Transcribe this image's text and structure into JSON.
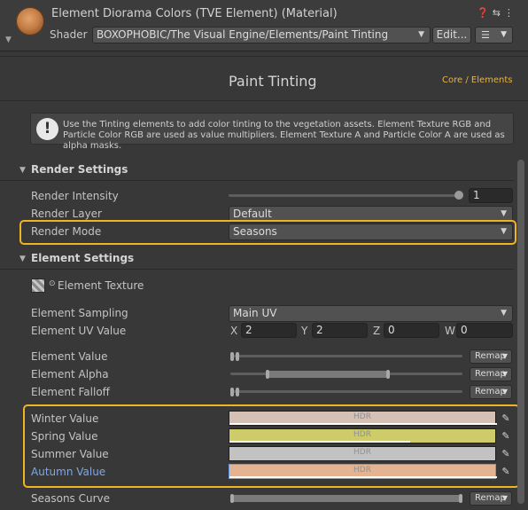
{
  "header": {
    "material_title": "Element Diorama Colors (TVE Element) (Material)",
    "shader_label": "Shader",
    "shader_value": "BOXOPHOBIC/The Visual Engine/Elements/Paint Tinting",
    "edit_label": "Edit...",
    "icons": [
      "help-icon",
      "settings-sliders-icon",
      "more-icon"
    ]
  },
  "title": {
    "text": "Paint Tinting",
    "link": "Core / Elements"
  },
  "help_text": "Use the Tinting elements to add color tinting to the vegetation assets. Element Texture RGB and Particle Color RGB are used as value multipliers. Element Texture A and Particle Color A are used as alpha masks.",
  "render_settings": {
    "header": "Render Settings",
    "intensity_label": "Render Intensity",
    "intensity_value": "1",
    "layer_label": "Render Layer",
    "layer_value": "Default",
    "mode_label": "Render Mode",
    "mode_value": "Seasons"
  },
  "element_settings": {
    "header": "Element Settings",
    "texture_label": "Element Texture",
    "sampling_label": "Element Sampling",
    "sampling_value": "Main UV",
    "uv_label": "Element UV Value",
    "uv": {
      "x": "2",
      "y": "2",
      "z": "0",
      "w": "0"
    },
    "uv_axis_labels": {
      "x": "X",
      "y": "Y",
      "z": "Z",
      "w": "W"
    },
    "value_label": "Element Value",
    "alpha_label": "Element Alpha",
    "falloff_label": "Element Falloff",
    "remap_label": "Remap"
  },
  "seasons": {
    "winter_label": "Winter Value",
    "spring_label": "Spring Value",
    "summer_label": "Summer Value",
    "autumn_label": "Autumn Value",
    "hdr": "HDR",
    "colors": {
      "winter": "#d4c0b4",
      "spring": "#cdcb6a",
      "summer": "#c2c2c2",
      "autumn": "#e4b492"
    },
    "curve_label": "Seasons Curve"
  },
  "colors": {
    "highlight": "#f0b323",
    "link": "#e6b44a",
    "autumn_label": "#7da7e8"
  }
}
